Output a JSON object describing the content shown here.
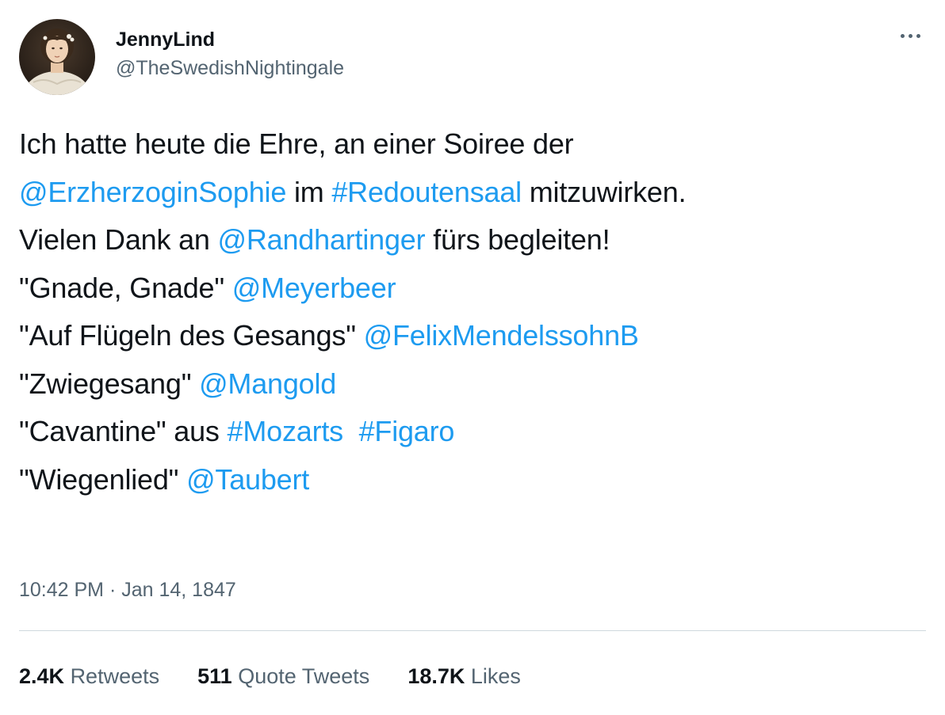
{
  "user": {
    "display_name": "JennyLind",
    "handle": "@TheSwedishNightingale",
    "avatar_icon": "portrait-avatar"
  },
  "more_icon": "more-horizontal-icon",
  "tweet": {
    "line1": {
      "text": "Ich hatte heute die Ehre, an einer Soiree der"
    },
    "line2": {
      "mention": "@ErzherzoginSophie",
      "t1": " im ",
      "hashtag": "#Redoutensaal",
      "t2": " mitzuwirken."
    },
    "line3": {
      "t1": "Vielen Dank an ",
      "mention": "@Randhartinger",
      "t2": " fürs begleiten!"
    },
    "line4": {
      "t1": "\"Gnade, Gnade\" ",
      "mention": "@Meyerbeer"
    },
    "line5": {
      "t1": "\"Auf Flügeln des Gesangs\" ",
      "mention": "@FelixMendelssohnB"
    },
    "line6": {
      "t1": "\"Zwiegesang\" ",
      "mention": "@Mangold"
    },
    "line7": {
      "t1": "\"Cavantine\" aus ",
      "hashtag1": "#Mozarts",
      "t2": "  ",
      "hashtag2": "#Figaro"
    },
    "line8": {
      "t1": "\"Wiegenlied\" ",
      "mention": "@Taubert"
    }
  },
  "meta": {
    "time": "10:42 PM",
    "separator": " · ",
    "date": "Jan 14, 1847"
  },
  "stats": {
    "retweets": {
      "count": "2.4K",
      "label": "Retweets"
    },
    "quote_tweets": {
      "count": "511",
      "label": "Quote Tweets"
    },
    "likes": {
      "count": "18.7K",
      "label": "Likes"
    }
  },
  "colors": {
    "link": "#1d9bf0",
    "text": "#0f1419",
    "secondary": "#536471",
    "divider": "#cfd9de"
  }
}
